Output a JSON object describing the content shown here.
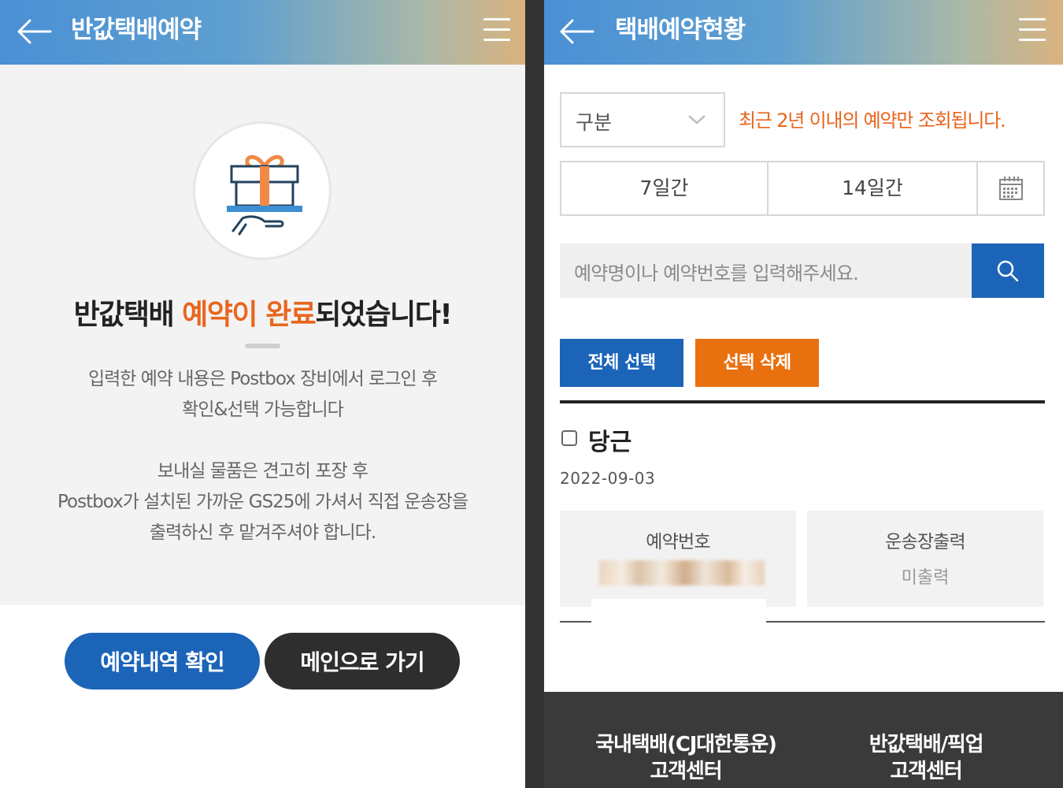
{
  "left": {
    "header": {
      "title": "반값택배예약"
    },
    "message": {
      "prefix": "반값택배 ",
      "accent": "예약이 완료",
      "suffix": "되었습니다!"
    },
    "info_lines_1": [
      "입력한 예약 내용은 Postbox 장비에서 로그인 후",
      "확인&선택 가능합니다"
    ],
    "info_lines_2": [
      "보내실 물품은 견고히 포장 후",
      "Postbox가 설치된 가까운 GS25에 가셔서 직접 운송장을",
      "출력하신 후 맡겨주셔야 합니다."
    ],
    "buttons": {
      "history": "예약내역 확인",
      "main": "메인으로 가기"
    }
  },
  "right": {
    "header": {
      "title": "택배예약현황"
    },
    "filter": {
      "type_label": "구분",
      "notice": "최근 2년 이내의 예약만 조회됩니다.",
      "periods": [
        "7일간",
        "14일간"
      ]
    },
    "search": {
      "placeholder": "예약명이나 예약번호를 입력해주세요."
    },
    "actions": {
      "select_all": "전체 선택",
      "delete": "선택 삭제"
    },
    "item": {
      "name": "당근",
      "date": "2022-09-03",
      "reservation_label": "예약번호",
      "label_print_label": "운송장출력",
      "label_print_value": "미출력"
    },
    "footer": {
      "cj_line1": "국내택배(CJ대한통운)",
      "cj_line2": "고객센터",
      "half_line1": "반값택배/픽업",
      "half_line2": "고객센터"
    }
  },
  "colors": {
    "accent_orange": "#e9651d",
    "primary_blue": "#1c64b8",
    "dark": "#2e2e2e"
  },
  "icons": [
    "back-arrow-icon",
    "hamburger-menu-icon",
    "gift-icon",
    "chevron-down-icon",
    "calendar-icon",
    "search-icon"
  ]
}
